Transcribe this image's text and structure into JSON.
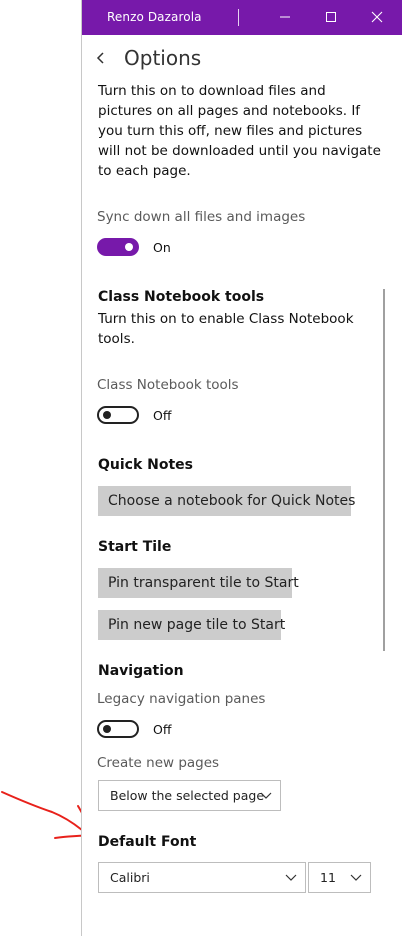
{
  "window": {
    "title": "Renzo Dazarola"
  },
  "header": {
    "title": "Options",
    "back_icon": "chevron-left-icon"
  },
  "download": {
    "paragraph_lines": [
      "Turn this on to download files and",
      "pictures on all pages and notebooks. If",
      "you turn this off, new files and pictures",
      "will not be downloaded until you navigate",
      "to each page."
    ],
    "toggle_label": "Sync down all files and images",
    "toggle_state": "On"
  },
  "class_notebook": {
    "title": "Class Notebook tools",
    "description_lines": [
      "Turn this on to enable Class Notebook",
      "tools."
    ],
    "toggle_label": "Class Notebook tools",
    "toggle_state": "Off"
  },
  "quick_notes": {
    "title": "Quick Notes",
    "button_label": "Choose a notebook for Quick Notes"
  },
  "start_tile": {
    "title": "Start Tile",
    "pin_transparent_label": "Pin transparent tile to Start",
    "pin_page_label": "Pin new page tile to Start"
  },
  "navigation": {
    "title": "Navigation",
    "legacy_label": "Legacy navigation panes",
    "legacy_state": "Off",
    "create_pages_label": "Create new pages",
    "create_pages_value": "Below the selected page"
  },
  "default_font": {
    "title": "Default Font",
    "font_value": "Calibri",
    "size_value": "11"
  },
  "colors": {
    "accent": "#7719aa",
    "annotation": "#e8211b"
  }
}
